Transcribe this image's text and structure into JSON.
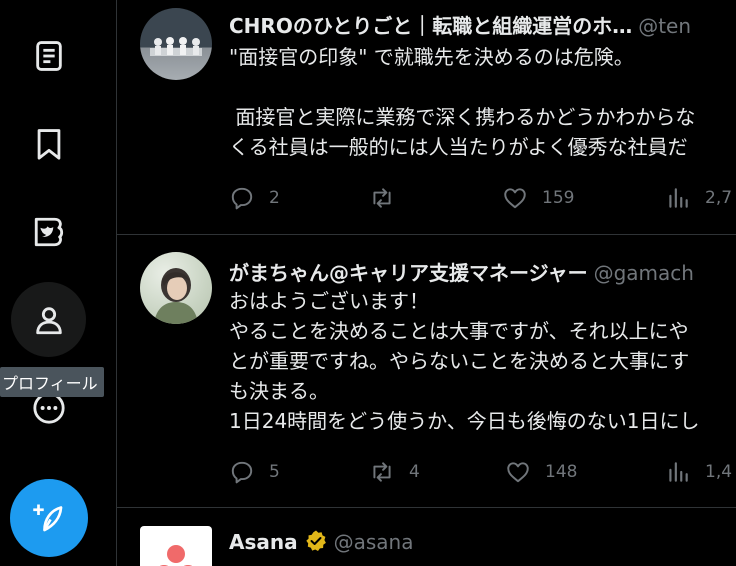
{
  "sidebar": {
    "tooltip": "プロフィール"
  },
  "tweets": [
    {
      "name": "CHROのひとりごと｜転職と組織運営のホ…",
      "handle": "@ten",
      "text": "\"面接官の印象\" で就職先を決めるのは危険。\n\n 面接官と実際に業務で深く携わるかどうかわからな\nくる社員は一般的には人当たりがよく優秀な社員だ",
      "replies": "2",
      "retweets": "",
      "likes": "159",
      "views": "2,7"
    },
    {
      "name": "がまちゃん@キャリア支援マネージャー",
      "handle": "@gamach",
      "text": "おはようございます！\nやることを決めることは大事ですが、それ以上にや\nとが重要ですね。やらないことを決めると大事にす\nも決まる。\n1日24時間をどう使うか、今日も後悔のない1日にし",
      "replies": "5",
      "retweets": "4",
      "likes": "148",
      "views": "1,4"
    },
    {
      "name": "Asana",
      "handle": "@asana"
    }
  ],
  "icons": {
    "nav": [
      "lists-icon",
      "bookmarks-icon",
      "twitter-blue-icon",
      "profile-icon",
      "more-icon"
    ],
    "compose": "compose-tweet-icon"
  },
  "colors": {
    "accent": "#1d9bf0",
    "background": "#000000",
    "muted": "#71767b",
    "verified": "#e2b719"
  }
}
